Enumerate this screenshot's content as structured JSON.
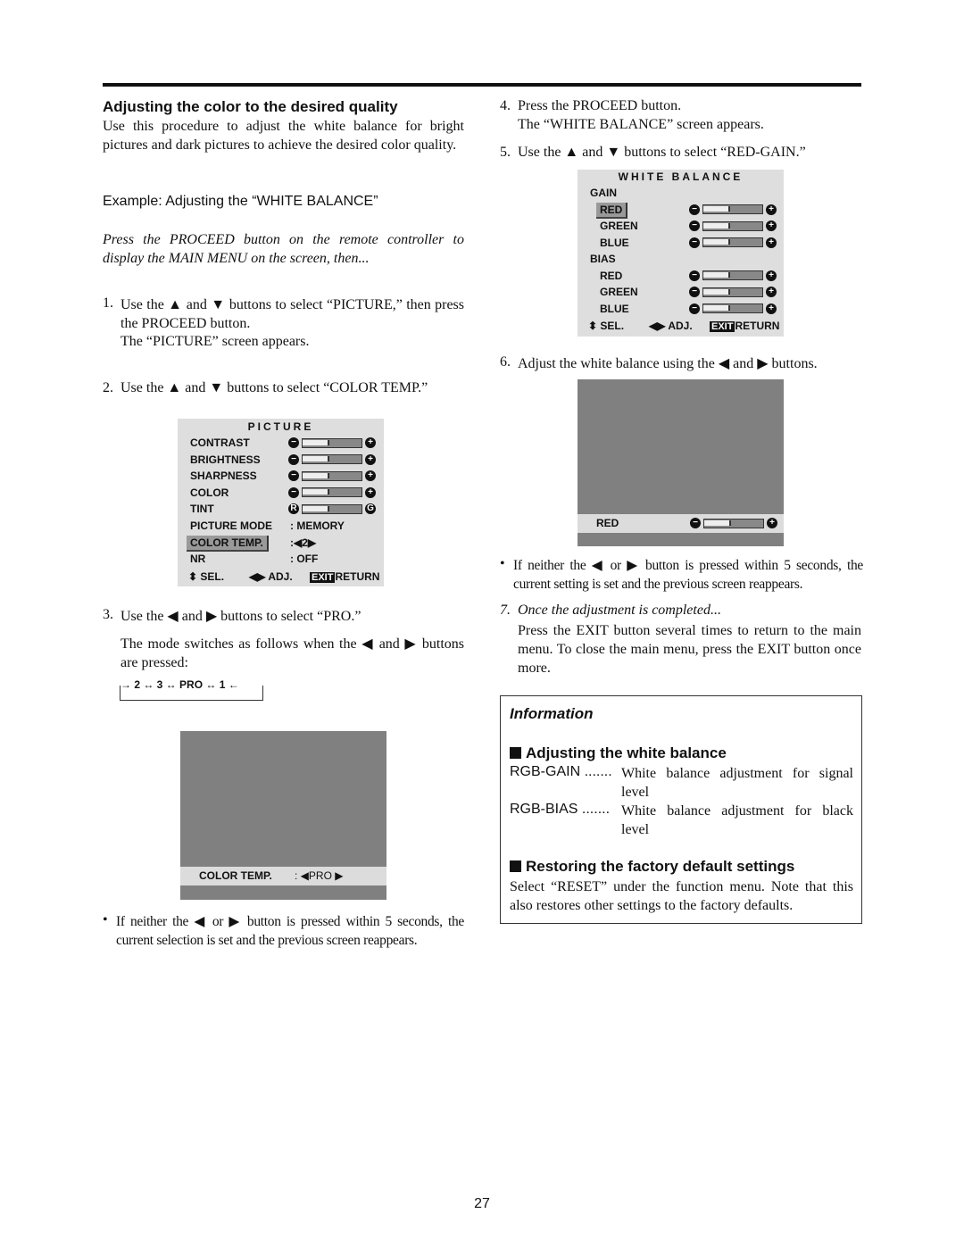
{
  "left": {
    "heading": "Adjusting the color to the desired quality",
    "intro": "Use this procedure to adjust the white balance for bright pictures and dark pictures to achieve the desired color quality.",
    "example": "Example: Adjusting the “WHITE BALANCE”",
    "note": "Press the PROCEED button on the remote controller to display the MAIN MENU on the screen, then...",
    "step1_num": "1.",
    "step1": "Use the ▲ and ▼ buttons to select “PICTURE,” then press the PROCEED button.",
    "step1b": "The “PICTURE” screen appears.",
    "step2_num": "2.",
    "step2": "Use the ▲ and ▼ buttons to select “COLOR TEMP.”",
    "step3_num": "3.",
    "step3": "Use the ◀ and ▶ buttons to select “PRO.”",
    "step3b": "The mode switches as follows when the ◀ and ▶ buttons are pressed:",
    "cycle": "→ 2 ↔ 3 ↔ PRO ↔ 1 ←",
    "bullet": "If neither the ◀ or ▶ button is pressed within 5 seconds, the current selection is set and the previous screen reappears."
  },
  "picture_menu": {
    "title": "PICTURE",
    "sliders": [
      {
        "label": "CONTRAST",
        "value": 0.5
      },
      {
        "label": "BRIGHTNESS",
        "value": 0.5
      },
      {
        "label": "SHARPNESS",
        "value": 0.5
      },
      {
        "label": "COLOR",
        "value": 0.5
      },
      {
        "label": "TINT",
        "value": 0.5,
        "left": "R",
        "right": "G"
      }
    ],
    "values": [
      {
        "label": "PICTURE MODE",
        "value": ":   MEMORY"
      },
      {
        "label": "COLOR TEMP.",
        "value": ":◀2▶",
        "selected": true
      },
      {
        "label": "NR",
        "value": ":   OFF"
      }
    ],
    "footer": {
      "sel": "⬍ SEL.",
      "adj": "◀▶ ADJ.",
      "exit": "EXIT",
      "return": "RETURN"
    }
  },
  "color_temp_screen": {
    "label": "COLOR TEMP.",
    "value": ": ◀PRO ▶"
  },
  "right": {
    "step4_num": "4.",
    "step4": "Press the PROCEED button.",
    "step4b": "The “WHITE BALANCE” screen appears.",
    "step5_num": "5.",
    "step5": "Use the ▲ and ▼ buttons to select “RED-GAIN.”",
    "step6_num": "6.",
    "step6": "Adjust the white balance using the ◀ and ▶ buttons.",
    "bullet": "If neither the ◀ or ▶ button is pressed within 5 seconds, the current setting is set and the previous screen reappears.",
    "step7_num": "7.",
    "step7": "Once the adjustment is completed...",
    "step7b": "Press the EXIT button several times to return to the main menu. To close the main menu, press the EXIT button once more."
  },
  "white_balance_menu": {
    "title": "WHITE BALANCE",
    "gain": "GAIN",
    "bias": "BIAS",
    "gain_rows": [
      {
        "label": "RED",
        "value": 0.5,
        "selected": true
      },
      {
        "label": "GREEN",
        "value": 0.5
      },
      {
        "label": "BLUE",
        "value": 0.5
      }
    ],
    "bias_rows": [
      {
        "label": "RED",
        "value": 0.5
      },
      {
        "label": "GREEN",
        "value": 0.5
      },
      {
        "label": "BLUE",
        "value": 0.5
      }
    ],
    "footer": {
      "sel": "⬍ SEL.",
      "adj": "◀▶ ADJ.",
      "exit": "EXIT",
      "return": "RETURN"
    }
  },
  "red_screen": {
    "label": "RED",
    "value": 0.5
  },
  "info": {
    "title": "Information",
    "h1": "Adjusting the white balance",
    "gain_term": "RGB-GAIN .......",
    "gain_desc": "White balance adjustment for signal level",
    "bias_term": "RGB-BIAS .......",
    "bias_desc": "White balance adjustment for black level",
    "h2": "Restoring the factory default settings",
    "reset": "Select “RESET” under the function menu. Note that this also restores other settings to the factory defaults."
  },
  "page_number": "27"
}
